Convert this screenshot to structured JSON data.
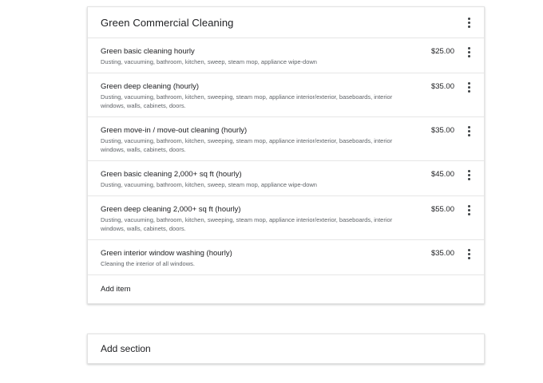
{
  "section": {
    "title": "Green Commercial Cleaning",
    "items": [
      {
        "title": "Green basic cleaning hourly",
        "description": "Dusting, vacuuming, bathroom, kitchen, sweep, steam mop, appliance wipe-down",
        "price": "$25.00"
      },
      {
        "title": "Green deep cleaning (hourly)",
        "description": "Dusting, vacuuming, bathroom, kitchen, sweeping, steam mop, appliance interior/exterior, baseboards, interior windows, walls, cabinets, doors.",
        "price": "$35.00"
      },
      {
        "title": "Green move-in / move-out cleaning (hourly)",
        "description": "Dusting, vacuuming, bathroom, kitchen, sweeping, steam mop, appliance interior/exterior, baseboards, interior windows, walls, cabinets, doors.",
        "price": "$35.00"
      },
      {
        "title": "Green basic cleaning 2,000+ sq ft (hourly)",
        "description": "Dusting, vacuuming, bathroom, kitchen, sweep, steam mop, appliance wipe-down",
        "price": "$45.00"
      },
      {
        "title": "Green deep cleaning 2,000+ sq ft (hourly)",
        "description": "Dusting, vacuuming, bathroom, kitchen, sweeping, steam mop, appliance interior/exterior, baseboards, interior windows, walls, cabinets, doors.",
        "price": "$55.00"
      },
      {
        "title": "Green interior window washing (hourly)",
        "description": "Cleaning the interior of all windows.",
        "price": "$35.00"
      }
    ],
    "add_item_label": "Add item",
    "menu_icon": "more-vert-icon"
  },
  "add_section_label": "Add section"
}
